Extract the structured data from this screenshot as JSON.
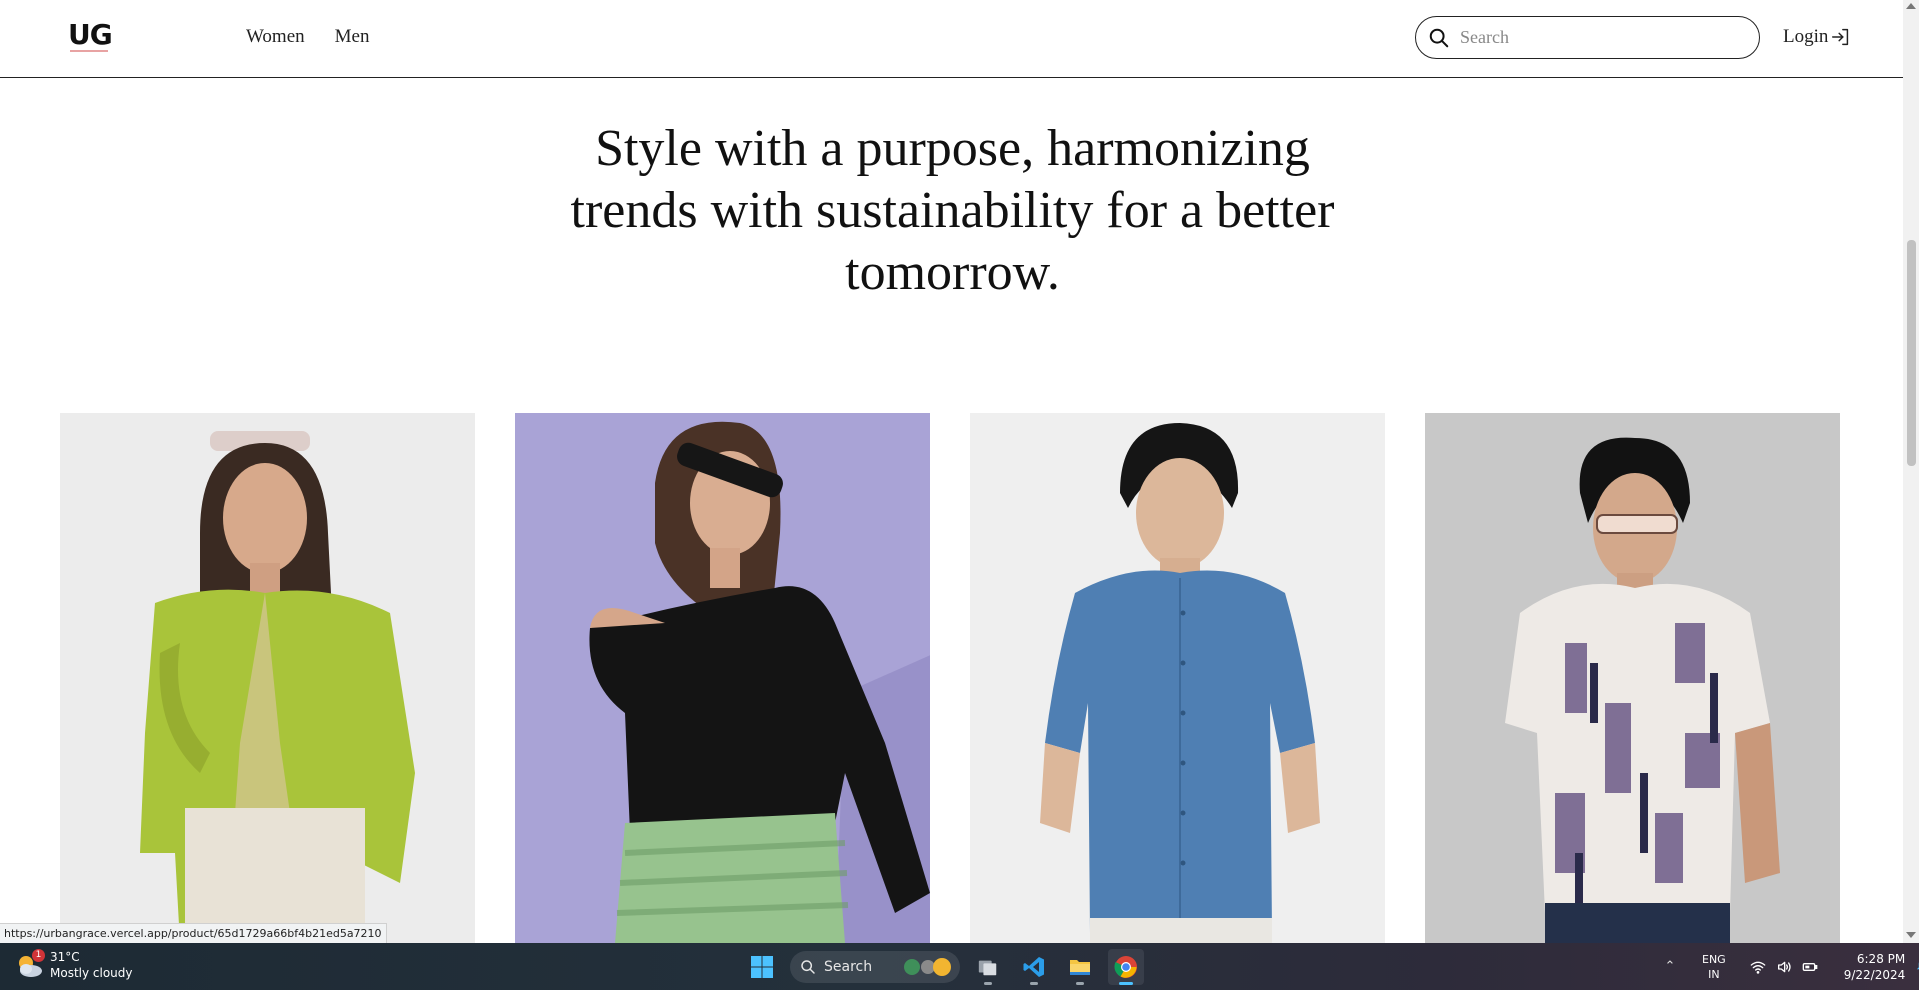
{
  "header": {
    "logo": "UG",
    "nav": [
      {
        "label": "Women"
      },
      {
        "label": "Men"
      }
    ],
    "search": {
      "placeholder": "Search",
      "value": ""
    },
    "login_label": "Login"
  },
  "hero": {
    "lines": [
      "Style with a purpose, harmonizing",
      "trends with sustainability for a better",
      "tomorrow."
    ]
  },
  "products": [
    {
      "name": "woman-lime-shirt",
      "bg": "#ececec",
      "garment": "#a9c43a"
    },
    {
      "name": "woman-black-offshoulder-top",
      "bg": "#a9a3d6",
      "garment": "#141414"
    },
    {
      "name": "man-blue-shirt",
      "bg": "#efefef",
      "garment": "#4f7fb3"
    },
    {
      "name": "man-printed-shirt",
      "bg": "#c8c8c8",
      "garment": "#eeeae6"
    }
  ],
  "status_url": "https://urbangrace.vercel.app/product/65d1729a66bf4b21ed5a7210",
  "taskbar": {
    "weather": {
      "temp": "31°C",
      "condition": "Mostly cloudy",
      "badge": "1"
    },
    "search_label": "Search",
    "apps": [
      {
        "icon": "task-view-icon"
      },
      {
        "icon": "vscode-icon"
      },
      {
        "icon": "file-explorer-icon"
      },
      {
        "icon": "chrome-icon",
        "active": true
      }
    ],
    "language": {
      "line1": "ENG",
      "line2": "IN"
    },
    "clock": {
      "time": "6:28 PM",
      "date": "9/22/2024"
    }
  },
  "colors": {
    "accent_windows": "#4cc2ff",
    "header_border": "#222222"
  }
}
